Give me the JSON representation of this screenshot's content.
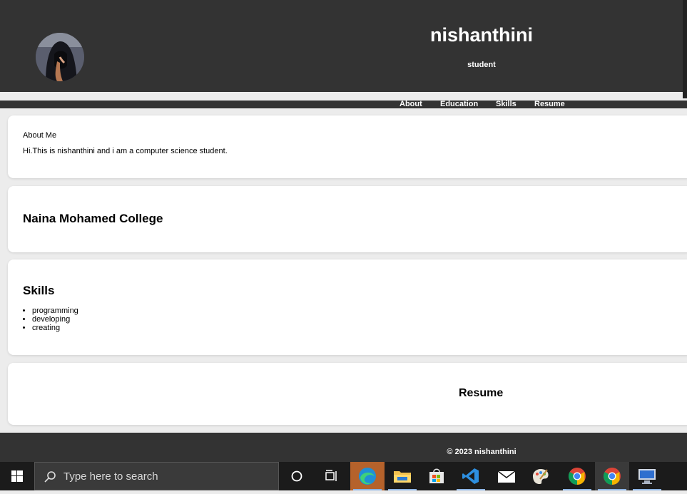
{
  "header": {
    "name": "nishanthini",
    "role": "student"
  },
  "nav": {
    "items": [
      "About",
      "Education",
      "Skills",
      "Resume"
    ]
  },
  "about": {
    "title": "About Me",
    "text": "Hi.This is nishanthini and i am a computer science student."
  },
  "education": {
    "title": "Naina Mohamed College"
  },
  "skills": {
    "title": "Skills",
    "items": [
      "programming",
      "developing",
      "creating"
    ]
  },
  "resume": {
    "title": "Resume"
  },
  "footer": {
    "text": "© 2023 nishanthini"
  },
  "taskbar": {
    "search_placeholder": "Type here to search",
    "apps": [
      "cortana-icon",
      "task-view-icon",
      "edge-icon",
      "file-explorer-icon",
      "store-icon",
      "vscode-icon",
      "mail-icon",
      "paint-icon",
      "chrome-icon",
      "chrome-icon",
      "remote-desktop-icon"
    ]
  }
}
